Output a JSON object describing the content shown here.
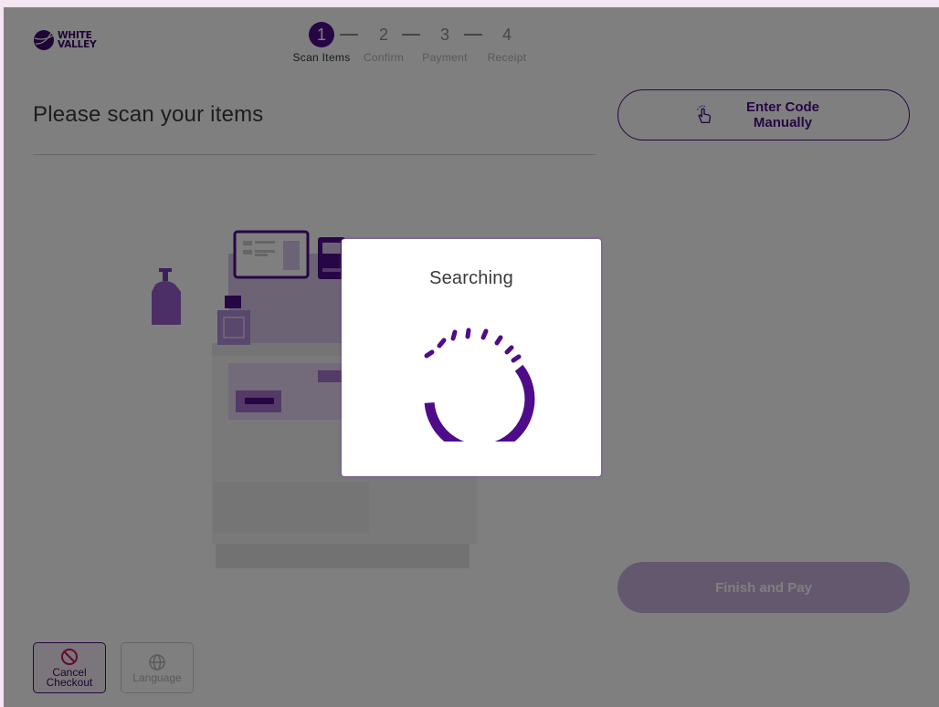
{
  "logo": {
    "line1": "WHITE",
    "line2": "VALLEY"
  },
  "stepper": {
    "steps": [
      {
        "number": "1",
        "label": "Scan Items"
      },
      {
        "number": "2",
        "label": "Confirm"
      },
      {
        "number": "3",
        "label": "Payment"
      },
      {
        "number": "4",
        "label": "Receipt"
      }
    ],
    "active_step": 1
  },
  "main": {
    "title": "Please scan your items"
  },
  "actions": {
    "enter_code_label": "Enter Code Manually",
    "finish_label": "Finish and Pay",
    "cancel_label": "Cancel Checkout",
    "language_label": "Language"
  },
  "modal": {
    "title": "Searching"
  },
  "colors": {
    "brand": "#4e0c8a",
    "brand_light": "#c9b1dd",
    "cancel_icon": "#c2185b"
  },
  "icons": {
    "logo": "planet-logo-icon",
    "enter_code": "touch-hand-icon",
    "cancel": "prohibited-icon",
    "language": "globe-icon",
    "spinner": "loading-spinner-icon"
  }
}
